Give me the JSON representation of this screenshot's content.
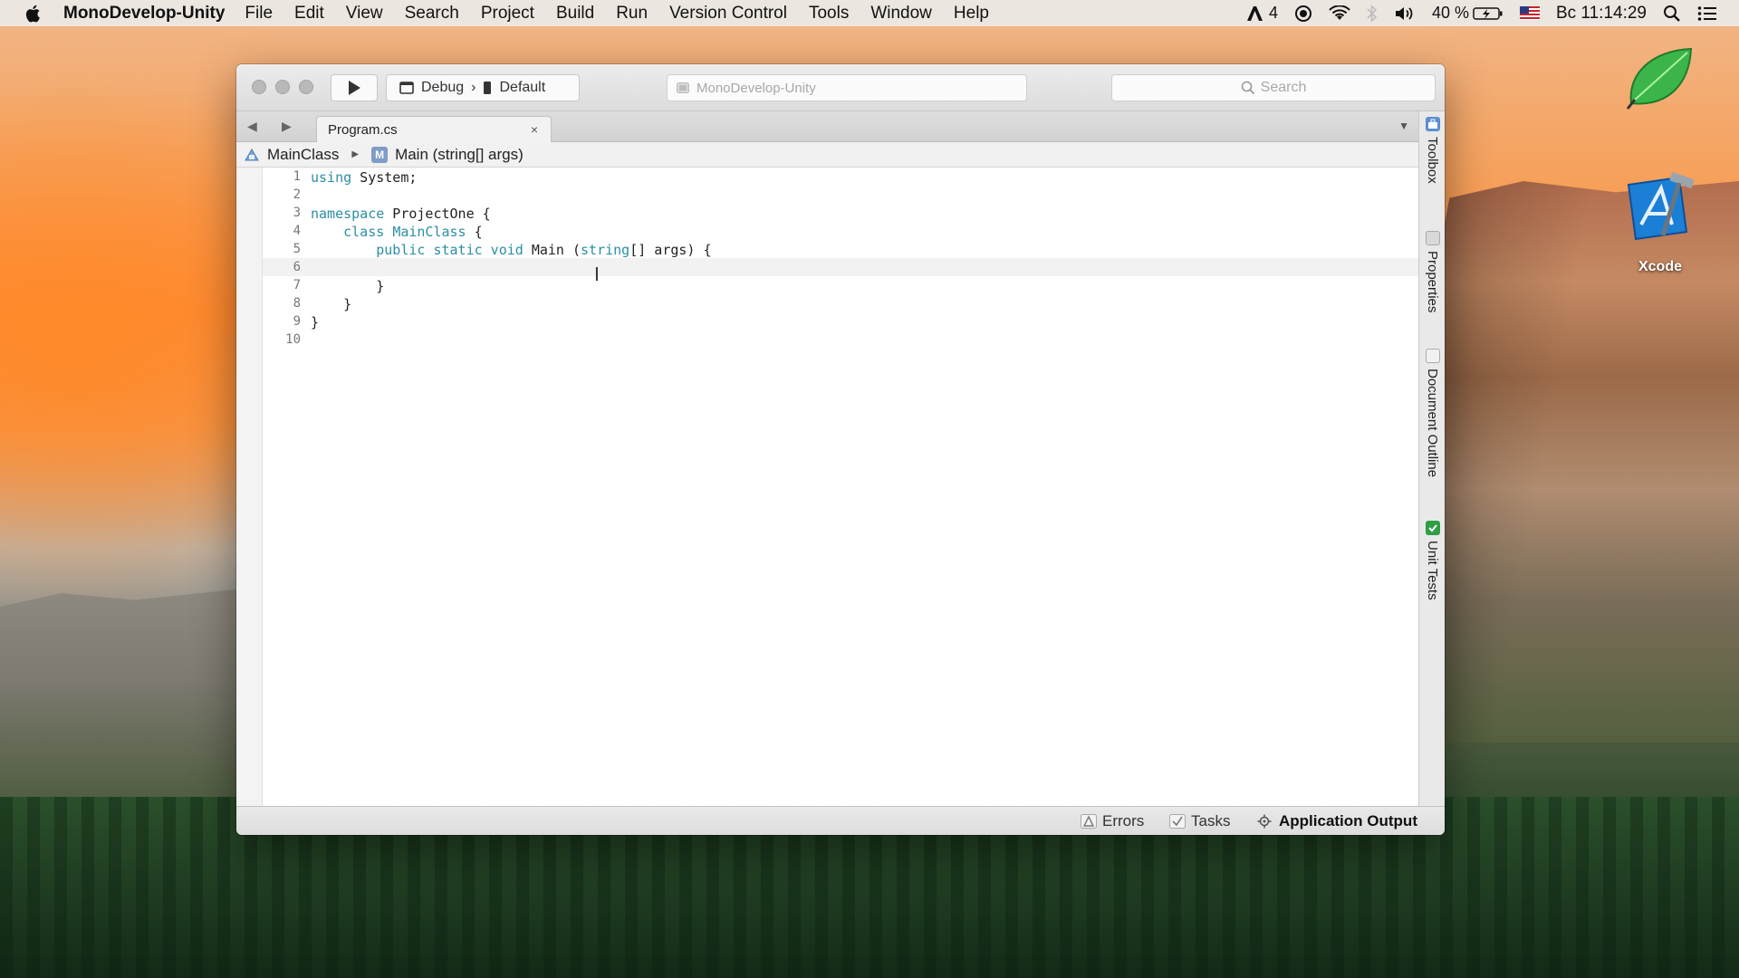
{
  "menubar": {
    "app_name": "MonoDevelop-Unity",
    "items": [
      "File",
      "Edit",
      "View",
      "Search",
      "Project",
      "Build",
      "Run",
      "Version Control",
      "Tools",
      "Window",
      "Help"
    ],
    "status": {
      "adobe_count": "4",
      "battery": "40 %",
      "clock": "Вс 11:14:29"
    }
  },
  "toolbar": {
    "config": "Debug",
    "config_separator": "›",
    "target": "Default",
    "status_text": "MonoDevelop-Unity",
    "search_placeholder": "Search"
  },
  "tabs": [
    {
      "label": "Program.cs",
      "close": "×"
    }
  ],
  "breadcrumb": {
    "class": "MainClass",
    "method_badge": "M",
    "method": "Main (string[] args)"
  },
  "code": {
    "line_numbers": [
      "1",
      "2",
      "3",
      "4",
      "5",
      "6",
      "7",
      "8",
      "9",
      "10"
    ],
    "current_line": 6
  },
  "pads": [
    "Toolbox",
    "Properties",
    "Document Outline",
    "Unit Tests"
  ],
  "bottom_pads": {
    "errors": "Errors",
    "tasks": "Tasks",
    "app_output": "Application Output"
  },
  "desktop": {
    "xcode_label": "Xcode"
  },
  "colors": {
    "keyword": "#2b8fa3",
    "type": "#2b8fa3"
  }
}
